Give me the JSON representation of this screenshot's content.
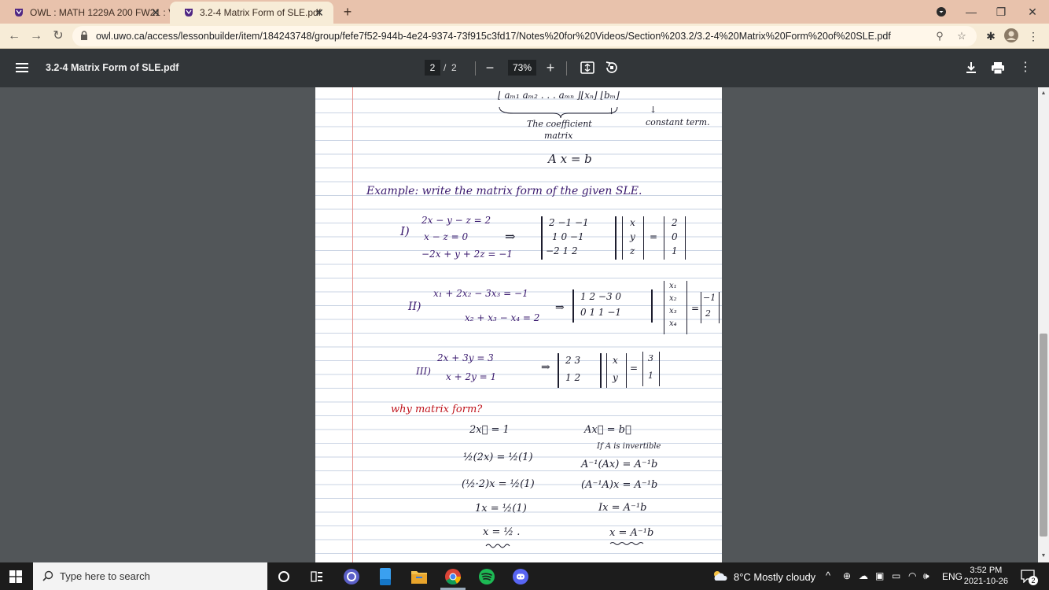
{
  "browser": {
    "tabs": [
      {
        "label": "OWL : MATH 1229A 200 FW21 : V"
      },
      {
        "label": "3.2-4 Matrix Form of SLE.pdf"
      }
    ],
    "url": "owl.uwo.ca/access/lessonbuilder/item/184243748/group/fefe7f52-944b-4e24-9374-73f915c3fd17/Notes%20for%20Videos/Section%203.2/3.2-4%20Matrix%20Form%20of%20SLE.pdf"
  },
  "pdf_viewer": {
    "title": "3.2-4 Matrix Form of SLE.pdf",
    "current_page": "2",
    "page_separator": "/",
    "total_pages": "2",
    "zoom": "73%",
    "zoom_out": "−",
    "zoom_in": "+"
  },
  "notes": {
    "matrix_row_top": "⌊ aₘ₁ aₘ₂ . . . aₘₙ ⌋⌊xₙ⌋   ⌊bₘ⌋",
    "arrow1": "↓",
    "arrow2": "↓",
    "coefficient_label_1": "The coefficient",
    "coefficient_label_2": "matrix",
    "constant_label": "constant term.",
    "axb": "A x = b",
    "example_heading": "Example: write the matrix form of the given SLE.",
    "ex1_label": "I)",
    "ex1_eq1": "2x − y − z = 2",
    "ex1_eq2": "x       − z = 0",
    "ex1_eq3": "−2x + y + 2z = −1",
    "ex1_implies": "⇒",
    "ex1_matrix": "[2 −1 −1; 1 0 −1; −2 1 2]",
    "ex1_row1": "2   −1   −1",
    "ex1_row2": "1    0   −1",
    "ex1_row3": "−2   1    2",
    "ex1_vars": [
      "x",
      "y",
      "z"
    ],
    "ex1_eq_sign": "=",
    "ex1_consts": [
      "2",
      "0",
      "1"
    ],
    "ex2_label": "II)",
    "ex2_eq1": "x₁ + 2x₂ − 3x₃       = −1",
    "ex2_eq2": "x₂ + x₃ − x₄ = 2",
    "ex2_implies": "⇒",
    "ex2_row1": "1   2  −3   0",
    "ex2_row2": "0   1   1  −1",
    "ex2_vars": [
      "x₁",
      "x₂",
      "x₃",
      "x₄"
    ],
    "ex2_eq_sign": "=",
    "ex2_consts": [
      "−1",
      "2"
    ],
    "ex3_label": "III)",
    "ex3_eq1": "2x + 3y = 3",
    "ex3_eq2": "x + 2y = 1",
    "ex3_implies": "⇒",
    "ex3_row1": "2   3",
    "ex3_row2": "1   2",
    "ex3_vars": [
      "x",
      "y"
    ],
    "ex3_eq_sign": "=",
    "ex3_consts": [
      "3",
      "1"
    ],
    "why_heading": "why matrix form?",
    "left_steps": [
      "2x⃗ = 1",
      "½(2x) = ½(1)",
      "(½·2)x = ½(1)",
      "1x = ½(1)",
      "x = ½ ."
    ],
    "right_steps": [
      "Ax⃗ = b⃗",
      "If A is invertible",
      "A⁻¹(Ax) = A⁻¹b",
      "(A⁻¹A)x = A⁻¹b",
      "Ix = A⁻¹b",
      "x = A⁻¹b"
    ]
  },
  "taskbar": {
    "search_placeholder": "Type here to search",
    "weather": "8°C  Mostly cloudy",
    "language": "ENG",
    "time": "3:52 PM",
    "date": "2021-10-26",
    "notification_count": "2"
  }
}
